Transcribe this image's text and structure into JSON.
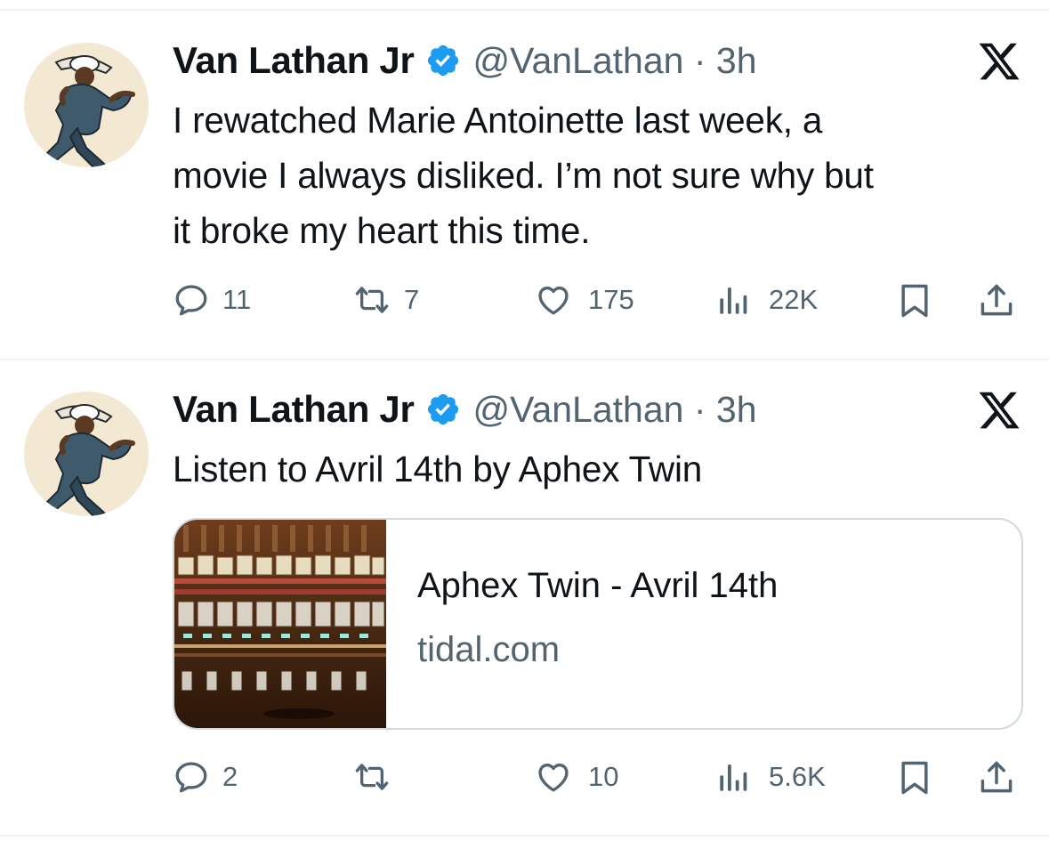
{
  "tweets": [
    {
      "display_name": "Van Lathan Jr",
      "handle_time": "@VanLathan · 3h",
      "lines": [
        "I rewatched Marie Antoinette last week, a",
        "movie I always disliked. I’m not sure why but",
        "it broke my heart this time."
      ],
      "replies": "11",
      "reposts": "7",
      "likes": "175",
      "views": "22K"
    },
    {
      "display_name": "Van Lathan Jr",
      "handle_time": "@VanLathan · 3h",
      "lines": [
        "Listen to Avril 14th by Aphex Twin"
      ],
      "card": {
        "title": "Aphex Twin - Avril 14th",
        "domain": "tidal.com"
      },
      "replies": "2",
      "reposts": "",
      "likes": "10",
      "views": "5.6K"
    }
  ],
  "colors": {
    "verified": "#1d9bf0",
    "muted": "#536471",
    "text": "#0f1419",
    "border": "#cfd9de"
  },
  "icons": [
    "avatar-illustration",
    "verified-badge-icon",
    "x-logo-icon",
    "reply-icon",
    "repost-icon",
    "like-icon",
    "views-icon",
    "bookmark-icon",
    "share-icon"
  ]
}
